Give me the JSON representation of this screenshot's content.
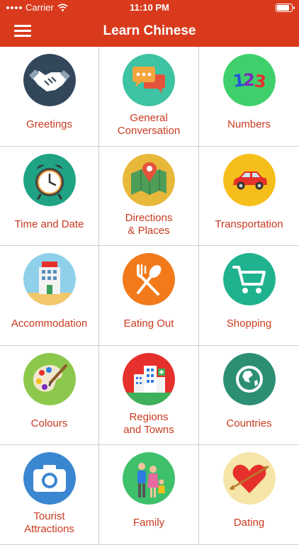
{
  "status_bar": {
    "carrier": "Carrier",
    "time": "11:10 PM"
  },
  "header": {
    "title": "Learn Chinese"
  },
  "colors": {
    "header_bg": "#d93a1c",
    "label_text": "#c93a1f"
  },
  "categories": [
    {
      "label": "Greetings",
      "icon": "handshake-icon"
    },
    {
      "label": "General\nConversation",
      "icon": "chat-bubbles-icon"
    },
    {
      "label": "Numbers",
      "icon": "numbers-icon"
    },
    {
      "label": "Time and Date",
      "icon": "alarm-clock-icon"
    },
    {
      "label": "Directions\n& Places",
      "icon": "map-pin-icon"
    },
    {
      "label": "Transportation",
      "icon": "car-icon"
    },
    {
      "label": "Accommodation",
      "icon": "hotel-icon"
    },
    {
      "label": "Eating Out",
      "icon": "fork-spoon-icon"
    },
    {
      "label": "Shopping",
      "icon": "shopping-cart-icon"
    },
    {
      "label": "Colours",
      "icon": "paint-palette-icon"
    },
    {
      "label": "Regions\nand Towns",
      "icon": "city-buildings-icon"
    },
    {
      "label": "Countries",
      "icon": "globe-icon"
    },
    {
      "label": "Tourist\nAttractions",
      "icon": "camera-icon"
    },
    {
      "label": "Family",
      "icon": "family-icon"
    },
    {
      "label": "Dating",
      "icon": "heart-arrow-icon"
    }
  ]
}
